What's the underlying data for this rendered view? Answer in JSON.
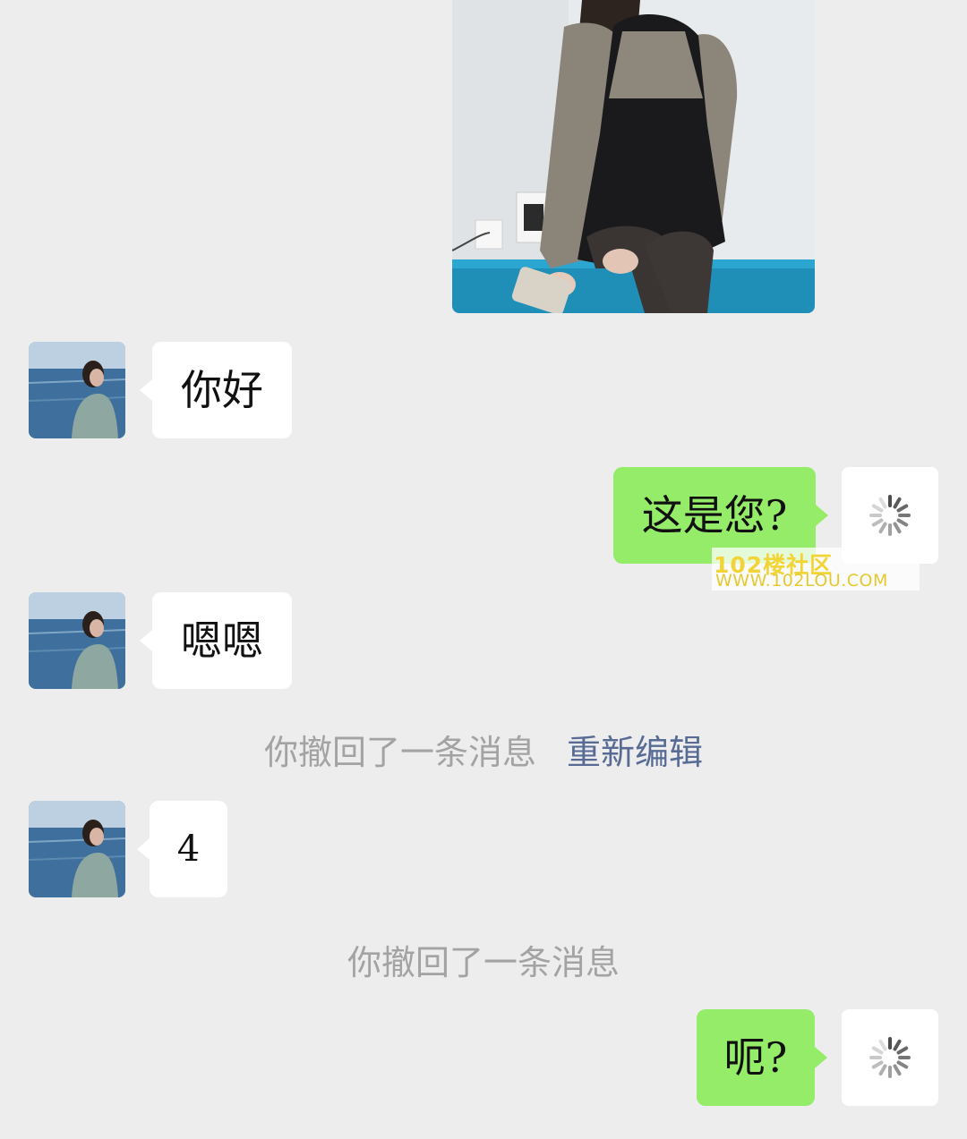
{
  "chat": {
    "messages": [
      {
        "side": "left",
        "text": "你好"
      },
      {
        "side": "right",
        "text": "这是您?"
      },
      {
        "side": "left",
        "text": "嗯嗯"
      },
      {
        "side": "left",
        "text": "4"
      },
      {
        "side": "right",
        "text": "呃?"
      }
    ]
  },
  "notices": {
    "recall_1": "你撤回了一条消息",
    "reedit_link": "重新编辑",
    "recall_2": "你撤回了一条消息"
  },
  "watermark": {
    "line1": "102楼社区",
    "line2": "WWW.102LOU.COM"
  },
  "colors": {
    "background": "#ededed",
    "incoming_bubble": "#ffffff",
    "outgoing_bubble": "#95ec69",
    "link": "#576b95",
    "notice_text": "#a3a3a3"
  }
}
